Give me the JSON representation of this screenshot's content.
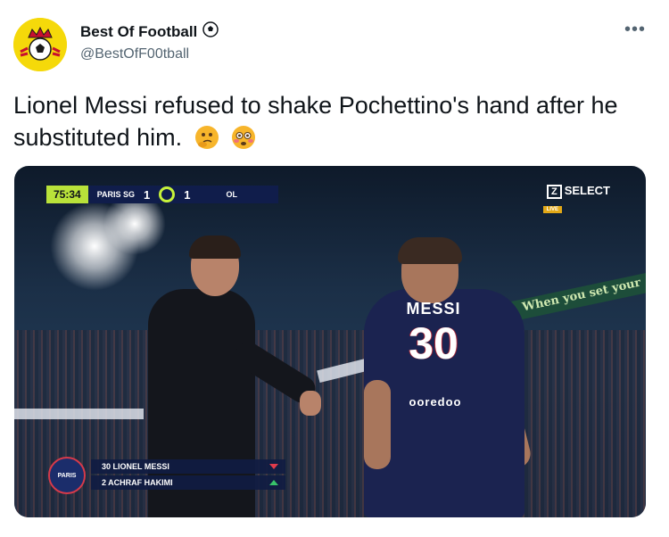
{
  "author": {
    "name": "Best Of Football",
    "handle": "@BestOfF00tball",
    "name_icon": "soccer-ball-icon"
  },
  "more_icon": "more-options-icon",
  "more_label": "•••",
  "tweet": {
    "text": "Lionel Messi refused to shake Pochettino's hand after he substituted him.",
    "emojis": [
      "thinking-face-icon",
      "flushed-face-icon"
    ]
  },
  "broadcast": {
    "clock": "75:34",
    "home_team": "PARIS SG",
    "home_score": "1",
    "away_score": "1",
    "away_team": "OL",
    "channel": "SELECT",
    "channel_prefix": "Z",
    "live_label": "LIVE",
    "stadium_banner": "When you set your"
  },
  "jersey": {
    "name": "MESSI",
    "number": "30",
    "sponsor": "ooredoo"
  },
  "substitution": {
    "badge": "PARIS",
    "out": "30 LIONEL MESSI",
    "in": "2 ACHRAF HAKIMI"
  },
  "colors": {
    "avatar_bg": "#f5d90a",
    "clock_bg": "#b9e23a",
    "scoreboard_bg": "#101d4b",
    "sub_out": "#e03b4b",
    "sub_in": "#38c46a"
  }
}
